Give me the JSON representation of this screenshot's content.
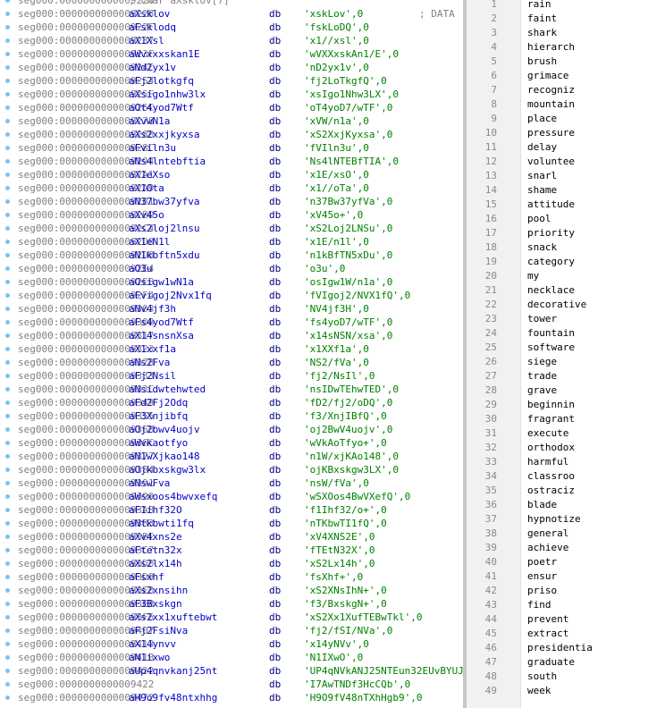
{
  "disasm": {
    "header_partial": "; char aXsklov[7]",
    "comment": "; DATA",
    "rows": [
      {
        "addr": "seg000:0000000000009228",
        "name": "aXsklov",
        "db": "db",
        "str": "'xskLov',0"
      },
      {
        "addr": "seg000:000000000000922F",
        "name": "aFsklodq",
        "db": "db",
        "str": "'fskLoDQ',0"
      },
      {
        "addr": "seg000:0000000000009237",
        "name": "aX1Xsl",
        "db": "db",
        "str": "'x1//xsl',0"
      },
      {
        "addr": "seg000:000000000000923F",
        "name": "aWvxxxskan1E",
        "db": "db",
        "str": "'wVXXxskAn1/E',0"
      },
      {
        "addr": "seg000:000000000000924C",
        "name": "aNd2yx1v",
        "db": "db",
        "str": "'nD2yx1v',0"
      },
      {
        "addr": "seg000:0000000000009254",
        "name": "aFj2lotkgfq",
        "db": "db",
        "str": "'fj2LoTkgfQ',0"
      },
      {
        "addr": "seg000:000000000000925F",
        "name": "aXsigo1nhw3lx",
        "db": "db",
        "str": "'xsIgo1Nhw3LX',0"
      },
      {
        "addr": "seg000:000000000000926C",
        "name": "aOt4yod7Wtf",
        "db": "db",
        "str": "'oT4yoD7/wTF',0"
      },
      {
        "addr": "seg000:0000000000009278",
        "name": "aXvwN1a",
        "db": "db",
        "str": "'xVW/n1a',0"
      },
      {
        "addr": "seg000:0000000000009280",
        "name": "aXs2xxjkyxsa",
        "db": "db",
        "str": "'xS2XxjKyxsa',0"
      },
      {
        "addr": "seg000:000000000000928C",
        "name": "aFviln3u",
        "db": "db",
        "str": "'fVIln3u',0"
      },
      {
        "addr": "seg000:0000000000009294",
        "name": "aNs4lntebftia",
        "db": "db",
        "str": "'Ns4lNTEBfTIA',0"
      },
      {
        "addr": "seg000:00000000000092A1",
        "name": "aX1eXso",
        "db": "db",
        "str": "'x1E/xsO',0"
      },
      {
        "addr": "seg000:00000000000092A9",
        "name": "aX1Ota",
        "db": "db",
        "str": "'x1//oTa',0"
      },
      {
        "addr": "seg000:00000000000092B1",
        "name": "aN37bw37yfva",
        "db": "db",
        "str": "'n37Bw37yfVa',0"
      },
      {
        "addr": "seg000:00000000000092BD",
        "name": "aXv45o",
        "db": "db",
        "str": "'xV45o+',0"
      },
      {
        "addr": "seg000:00000000000092C4",
        "name": "aXs2loj2lnsu",
        "db": "db",
        "str": "'xS2Loj2LNSu',0"
      },
      {
        "addr": "seg000:00000000000092D0",
        "name": "aX1eN1l",
        "db": "db",
        "str": "'x1E/n1l',0"
      },
      {
        "addr": "seg000:00000000000092D8",
        "name": "aN1kbftn5xdu",
        "db": "db",
        "str": "'n1kBfTN5xDu',0"
      },
      {
        "addr": "seg000:00000000000092E4",
        "name": "aO3u",
        "db": "db",
        "str": "'o3u',0"
      },
      {
        "addr": "seg000:00000000000092E8",
        "name": "aOsigw1wN1a",
        "db": "db",
        "str": "'osIgw1W/n1a',0"
      },
      {
        "addr": "seg000:00000000000092F4",
        "name": "aFvigoj2Nvx1fq",
        "db": "db",
        "str": "'fVIgoj2/NVX1fQ',0"
      },
      {
        "addr": "seg000:0000000000009303",
        "name": "aNv4jf3h",
        "db": "db",
        "str": "'NV4jf3H',0"
      },
      {
        "addr": "seg000:000000000000930B",
        "name": "aFs4yod7Wtf",
        "db": "db",
        "str": "'fs4yoD7/wTF',0"
      },
      {
        "addr": "seg000:0000000000009317",
        "name": "aX14snsnXsa",
        "db": "db",
        "str": "'x14sNSN/xsa',0"
      },
      {
        "addr": "seg000:0000000000009323",
        "name": "aX1xxf1a",
        "db": "db",
        "str": "'x1XXf1a',0"
      },
      {
        "addr": "seg000:000000000000932B",
        "name": "aNs2Fva",
        "db": "db",
        "str": "'NS2/fVa',0"
      },
      {
        "addr": "seg000:0000000000009333",
        "name": "aFj2Nsil",
        "db": "db",
        "str": "'fj2/NsIl',0"
      },
      {
        "addr": "seg000:000000000000933C",
        "name": "aNsidwtehwted",
        "db": "db",
        "str": "'nsIDwTEhwTED',0"
      },
      {
        "addr": "seg000:0000000000009349",
        "name": "aFd2Fj2Odq",
        "db": "db",
        "str": "'fD2/fj2/oDQ',0"
      },
      {
        "addr": "seg000:0000000000009355",
        "name": "aF3Xnjibfq",
        "db": "db",
        "str": "'f3/XnjIBfQ',0"
      },
      {
        "addr": "seg000:0000000000009360",
        "name": "aOj2bwv4uojv",
        "db": "db",
        "str": "'oj2BwV4uojv',0"
      },
      {
        "addr": "seg000:000000000000936C",
        "name": "aWvkaotfyo",
        "db": "db",
        "str": "'wVkAoTfyo+',0"
      },
      {
        "addr": "seg000:0000000000009377",
        "name": "aN1wXjkao148",
        "db": "db",
        "str": "'n1W/xjKAo148',0"
      },
      {
        "addr": "seg000:0000000000009384",
        "name": "aOjkbxskgw3lx",
        "db": "db",
        "str": "'ojKBxskgw3LX',0"
      },
      {
        "addr": "seg000:0000000000009391",
        "name": "aNswFva",
        "db": "db",
        "str": "'nsW/fVa',0"
      },
      {
        "addr": "seg000:0000000000009399",
        "name": "aWsxoos4bwvxefq",
        "db": "db",
        "str": "'wSXOos4BwVXefQ',0"
      },
      {
        "addr": "seg000:00000000000093A8",
        "name": "aF1ihf32O",
        "db": "db",
        "str": "'f1Ihf32/o+',0"
      },
      {
        "addr": "seg000:00000000000093B3",
        "name": "aNtkbwti1fq",
        "db": "db",
        "str": "'nTKbwTI1fQ',0"
      },
      {
        "addr": "seg000:00000000000093BE",
        "name": "aXv4xns2e",
        "db": "db",
        "str": "'xV4XNS2E',0"
      },
      {
        "addr": "seg000:00000000000093C7",
        "name": "aFtetn32x",
        "db": "db",
        "str": "'fTEtN32X',0"
      },
      {
        "addr": "seg000:00000000000093D0",
        "name": "aXs2lx14h",
        "db": "db",
        "str": "'xS2Lx14h',0"
      },
      {
        "addr": "seg000:00000000000093D9",
        "name": "aFsxhf",
        "db": "db",
        "str": "'fsXhf+',0"
      },
      {
        "addr": "seg000:00000000000093E0",
        "name": "aXs2xnsihn",
        "db": "db",
        "str": "'xS2XNsIhN+',0"
      },
      {
        "addr": "seg000:00000000000093EB",
        "name": "aF3Bxskgn",
        "db": "db",
        "str": "'f3/BxskgN+',0"
      },
      {
        "addr": "seg000:00000000000093F6",
        "name": "aXs2xx1xuftebwt",
        "db": "db",
        "str": "'xS2Xx1XufTEBwTkl',0"
      },
      {
        "addr": "seg000:0000000000009407",
        "name": "aFj2FsiNva",
        "db": "db",
        "str": "'fj2/fSI/NVa',0"
      },
      {
        "addr": "seg000:0000000000009413",
        "name": "aX14ynvv",
        "db": "db",
        "str": "'x14yNVv',0"
      },
      {
        "addr": "seg000:000000000000941B",
        "name": "aN1ixwo",
        "db": "db",
        "str": "'N1IXwO',0"
      },
      {
        "addr": "seg000:0000000000009422",
        "name": "aUp4qnvkanj25nt",
        "db": "db",
        "str": "'UP4qNVkANJ25NTEun32EUvBYUJI"
      },
      {
        "addr": "seg000:0000000000009422",
        "name": "",
        "db": "db",
        "str": "'I7AwTNDf3HcCQb',0"
      },
      {
        "addr": "seg000:0000000000009472",
        "name": "aH9o9fv48ntxhhg",
        "db": "db",
        "str": "'H9O9fV48nTXhHgb9',0"
      }
    ]
  },
  "wordlist": [
    "rain",
    "faint",
    "shark",
    "hierarch",
    "brush",
    "grimace",
    "recogniz",
    "mountain",
    "place",
    "pressure",
    "delay",
    "voluntee",
    "snarl",
    "shame",
    "attitude",
    "pool",
    "priority",
    "snack",
    "category",
    "my",
    "necklace",
    "decorative",
    "tower",
    "fountain",
    "software",
    "siege",
    "trade",
    "grave",
    "beginnin",
    "fragrant",
    "execute",
    "orthodox",
    "harmful",
    "classroo",
    "ostraciz",
    "blade",
    "hypnotize",
    "general",
    "achieve",
    "poetr",
    "ensur",
    "priso",
    "find",
    "prevent",
    "extract",
    "presidentia",
    "graduate",
    "south",
    "week"
  ]
}
